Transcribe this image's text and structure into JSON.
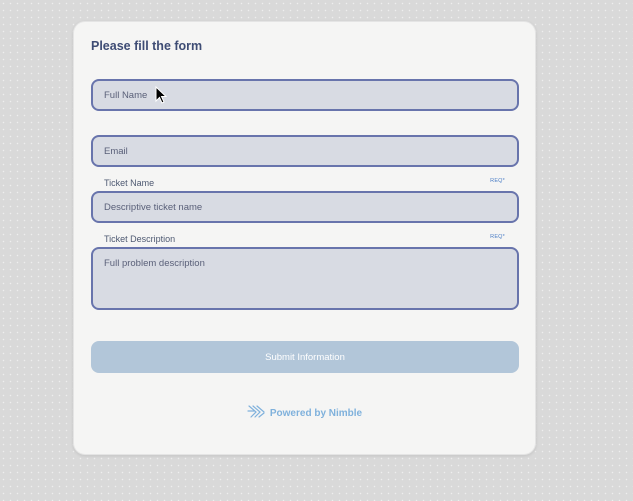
{
  "form": {
    "title": "Please fill the form",
    "full_name_placeholder": "Full Name",
    "email_placeholder": "Email",
    "ticket_name_label": "Ticket Name",
    "ticket_name_req": "REQ*",
    "ticket_name_placeholder": "Descriptive ticket name",
    "ticket_description_label": "Ticket Description",
    "ticket_description_req": "REQ*",
    "ticket_description_placeholder": "Full problem description",
    "submit_label": "Submit Information"
  },
  "footer": {
    "powered_by": "Powered by Nimble",
    "logo_icon": "nimble-logo-icon"
  },
  "colors": {
    "field_border": "#6874ac",
    "field_bg": "#d8dbe3",
    "submit_bg": "#b2c6d9",
    "title": "#3e4c74",
    "accent": "#4d7fc6",
    "powered": "#7fb1dc"
  }
}
